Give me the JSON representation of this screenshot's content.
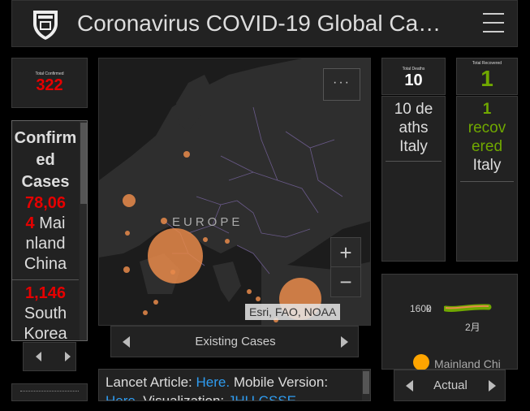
{
  "header": {
    "title": "Coronavirus COVID-19 Global Ca…",
    "logo_icon": "university-shield-icon",
    "menu_icon": "hamburger-menu-icon"
  },
  "total_confirmed": {
    "label": "Total Confirmed",
    "value": "322"
  },
  "confirmed_by_region": {
    "heading_lines": [
      "Confirm",
      "ed",
      "Cases"
    ],
    "items": [
      {
        "count_lines": [
          "78,06",
          "4"
        ],
        "place_first": "Mai",
        "place_lines": [
          "nland",
          "China"
        ]
      },
      {
        "count": "1,146",
        "place_lines": [
          "South",
          "Korea"
        ]
      }
    ]
  },
  "map": {
    "region_label": "EUROPE",
    "more_label": "···",
    "zoom_in": "+",
    "zoom_out": "−",
    "attribution": "Esri, FAO, NOAA",
    "bottom_tab": "Existing Cases"
  },
  "deaths": {
    "label": "Total Deaths",
    "value": "10",
    "item_lines": [
      "10 de",
      "aths",
      "Italy"
    ]
  },
  "recovered": {
    "label": "Total Recovered",
    "value": "1",
    "item_lines_green": [
      "1",
      "recov",
      "ered"
    ],
    "item_place": "Italy"
  },
  "chart": {
    "y_label": "160k",
    "y_label_overlap": "0",
    "x_label": "2月",
    "legend": "Mainland Chi",
    "bottom_tab": "Actual"
  },
  "footer": {
    "lancet_prefix": "Lancet Article: ",
    "lancet_link": "Here.",
    "mobile_text": " Mobile Version:",
    "second_line_link": "Here.",
    "second_line_text": " Visualization: ",
    "second_line_link2": "JHU CSSE"
  },
  "colors": {
    "accent_red": "#e60000",
    "accent_green": "#70a800",
    "bubble": "#e8894a",
    "link": "#2f9cf0"
  }
}
